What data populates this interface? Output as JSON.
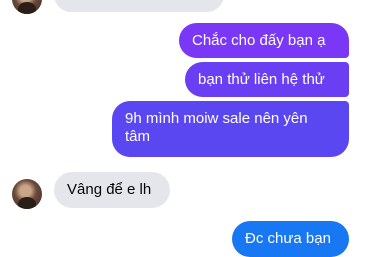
{
  "messages": [
    {
      "side": "received",
      "text": "",
      "color": "#e4e6eb"
    },
    {
      "side": "sent",
      "text": "Chắc cho đấy bạn ạ",
      "color": "#7a37f5"
    },
    {
      "side": "sent",
      "text": "bạn thử liên hệ thử",
      "color": "#6a3ff3"
    },
    {
      "side": "sent",
      "text": "9h mình moiw sale nên yên tâm",
      "color": "#5a47f1"
    },
    {
      "side": "received",
      "text": "Vâng để e lh",
      "color": "#e4e6eb"
    },
    {
      "side": "sent",
      "text": "Đc chưa bạn",
      "color": "#1877f2"
    }
  ],
  "contact": {
    "avatar_icon": "user-avatar"
  }
}
